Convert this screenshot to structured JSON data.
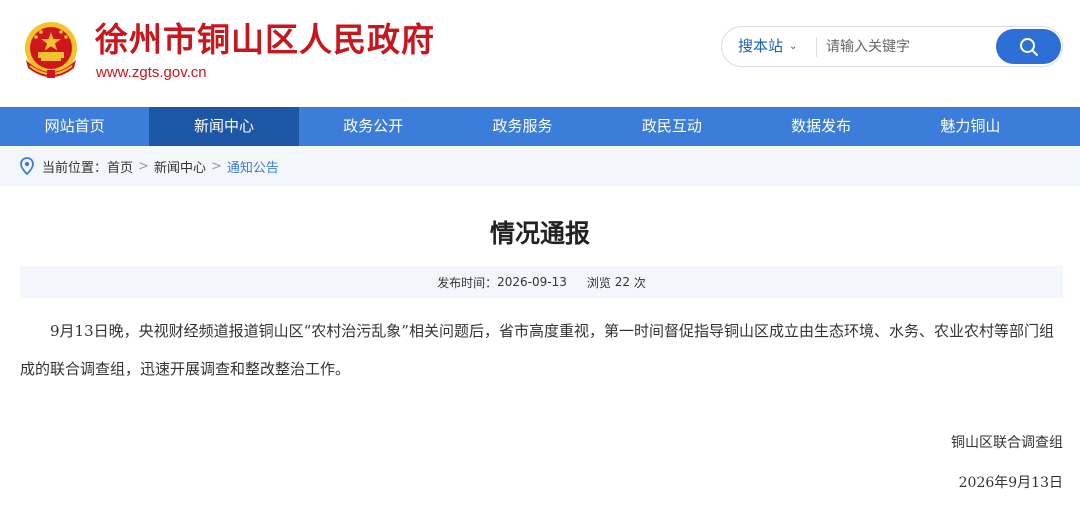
{
  "header": {
    "site_title": "徐州市铜山区人民政府",
    "site_url": "www.zgts.gov.cn",
    "search": {
      "scope_label": "搜本站",
      "placeholder": "请输入关键字"
    }
  },
  "nav": {
    "items": [
      {
        "label": "网站首页",
        "active": false
      },
      {
        "label": "新闻中心",
        "active": true
      },
      {
        "label": "政务公开",
        "active": false
      },
      {
        "label": "政务服务",
        "active": false
      },
      {
        "label": "政民互动",
        "active": false
      },
      {
        "label": "数据发布",
        "active": false
      },
      {
        "label": "魅力铜山",
        "active": false
      }
    ]
  },
  "breadcrumb": {
    "prefix": "当前位置：",
    "items": [
      "首页",
      "新闻中心",
      "通知公告"
    ],
    "separator": ">"
  },
  "article": {
    "title": "情况通报",
    "publish_label": "发布时间：",
    "publish_date": "2026-09-13",
    "views_label": "浏览",
    "views_count": "22",
    "views_unit": "次",
    "body": "9月13日晚，央视财经频道报道铜山区“农村治污乱象”相关问题后，省市高度重视，第一时间督促指导铜山区成立由生态环境、水务、农业农村等部门组成的联合调查组，迅速开展调查和整改整治工作。",
    "signature_org": "铜山区联合调查组",
    "signature_date": "2026年9月13日"
  },
  "colors": {
    "brand_red": "#c8161d",
    "nav_blue": "#3b7dd8",
    "nav_active": "#1e56a6",
    "search_button": "#2d6fd4"
  },
  "icons": {
    "emblem": "national-emblem-icon",
    "search": "search-icon",
    "chevron": "chevron-down-icon",
    "location": "location-pin-icon"
  }
}
